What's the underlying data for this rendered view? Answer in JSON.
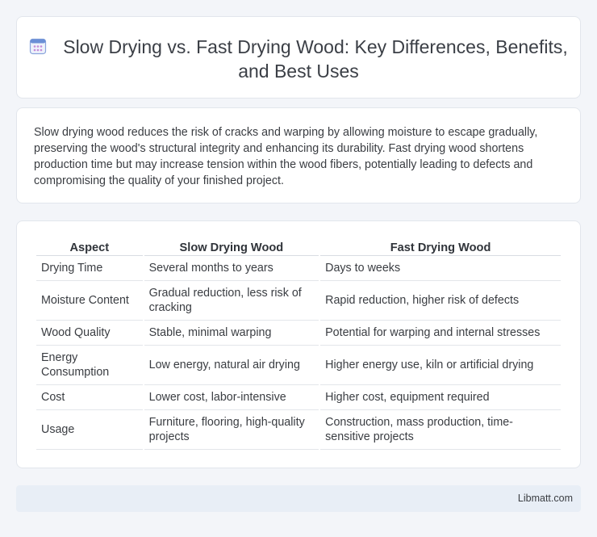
{
  "header": {
    "icon": "calendar-icon",
    "title": "Slow Drying vs. Fast Drying Wood: Key Differences, Benefits, and Best Uses"
  },
  "intro": {
    "text": "Slow drying wood reduces the risk of cracks and warping by allowing moisture to escape gradually, preserving the wood's structural integrity and enhancing its durability. Fast drying wood shortens production time but may increase tension within the wood fibers, potentially leading to defects and compromising the quality of your finished project."
  },
  "table": {
    "headers": [
      "Aspect",
      "Slow Drying Wood",
      "Fast Drying Wood"
    ],
    "rows": [
      [
        "Drying Time",
        "Several months to years",
        "Days to weeks"
      ],
      [
        "Moisture Content",
        "Gradual reduction, less risk of cracking",
        "Rapid reduction, higher risk of defects"
      ],
      [
        "Wood Quality",
        "Stable, minimal warping",
        "Potential for warping and internal stresses"
      ],
      [
        "Energy Consumption",
        "Low energy, natural air drying",
        "Higher energy use, kiln or artificial drying"
      ],
      [
        "Cost",
        "Lower cost, labor-intensive",
        "Higher cost, equipment required"
      ],
      [
        "Usage",
        "Furniture, flooring, high-quality projects",
        "Construction, mass production, time-sensitive projects"
      ]
    ]
  },
  "footer": {
    "brand": "Libmatt.com"
  },
  "colors": {
    "background": "#f3f5f9",
    "card": "#ffffff",
    "footer": "#e8eef6",
    "icon_accent": "#6b8fd6"
  }
}
